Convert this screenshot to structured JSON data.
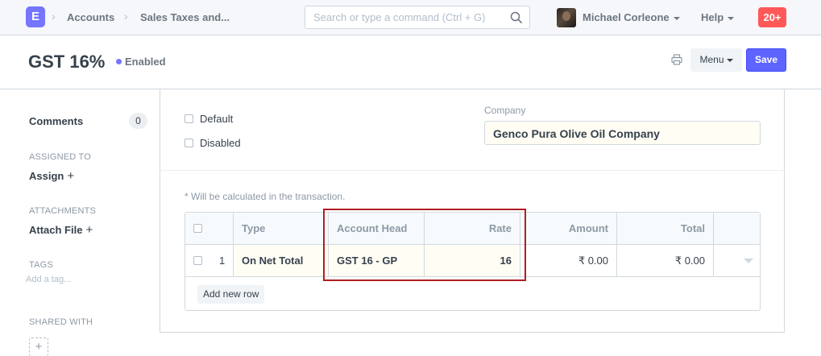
{
  "navbar": {
    "logo_letter": "E",
    "breadcrumbs": [
      "Accounts",
      "Sales Taxes and..."
    ],
    "search_placeholder": "Search or type a command (Ctrl + G)",
    "user_name": "Michael Corleone",
    "help_label": "Help",
    "notification_count": "20+"
  },
  "page": {
    "title": "GST 16%",
    "status": "Enabled",
    "menu_label": "Menu",
    "save_label": "Save"
  },
  "sidebar": {
    "comments_label": "Comments",
    "comments_count": "0",
    "assigned_to_label": "ASSIGNED TO",
    "assign_label": "Assign",
    "attachments_label": "ATTACHMENTS",
    "attach_file_label": "Attach File",
    "tags_label": "TAGS",
    "add_tag_placeholder": "Add a tag...",
    "shared_with_label": "SHARED WITH"
  },
  "form": {
    "default_label": "Default",
    "disabled_label": "Disabled",
    "company_label": "Company",
    "company_value": "Genco Pura Olive Oil Company",
    "note": "* Will be calculated in the transaction.",
    "add_row_label": "Add new row"
  },
  "taxes_table": {
    "columns": [
      "Type",
      "Account Head",
      "Rate",
      "Amount",
      "Total"
    ],
    "rows": [
      {
        "idx": "1",
        "type": "On Net Total",
        "account_head": "GST 16 - GP",
        "rate": "16",
        "amount": "₹ 0.00",
        "total": "₹ 0.00"
      }
    ]
  },
  "colors": {
    "primary": "#5e64ff",
    "logo": "#7575ff",
    "notification": "#ff5858",
    "highlight_box": "#b01e22"
  }
}
